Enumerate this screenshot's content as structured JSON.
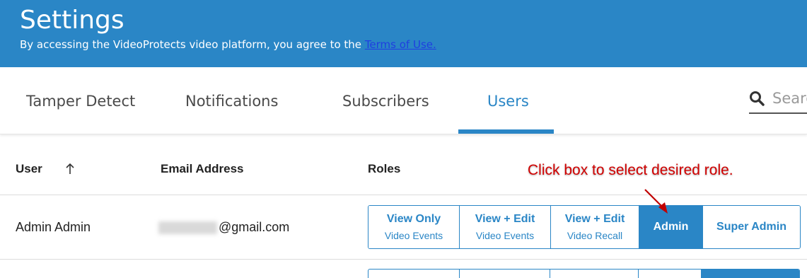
{
  "header": {
    "title": "Settings",
    "subtitle": "By accessing the VideoProtects video platform, you agree to the ",
    "terms_link": "Terms of Use."
  },
  "tabs": [
    {
      "label": "Tamper Detect",
      "active": false
    },
    {
      "label": "Notifications",
      "active": false
    },
    {
      "label": "Subscribers",
      "active": false
    },
    {
      "label": "Users",
      "active": true
    }
  ],
  "search": {
    "placeholder": "Search",
    "visible_text": "Searc"
  },
  "table": {
    "columns": [
      "User",
      "Email Address",
      "Roles"
    ],
    "rows": [
      {
        "user": "Admin Admin",
        "email_suffix": "@gmail.com"
      }
    ]
  },
  "roles": [
    {
      "line1": "View Only",
      "line2": "Video Events",
      "selected": false
    },
    {
      "line1": "View + Edit",
      "line2": "Video Events",
      "selected": false
    },
    {
      "line1": "View + Edit",
      "line2": "Video Recall",
      "selected": false
    },
    {
      "line1": "Admin",
      "line2": "",
      "selected": true
    },
    {
      "line1": "Super Admin",
      "line2": "",
      "selected": false
    }
  ],
  "annotation": "Click box to select desired role.",
  "colors": {
    "accent": "#2a86c6",
    "annotation": "#d10000",
    "link": "#1f3fe0"
  }
}
